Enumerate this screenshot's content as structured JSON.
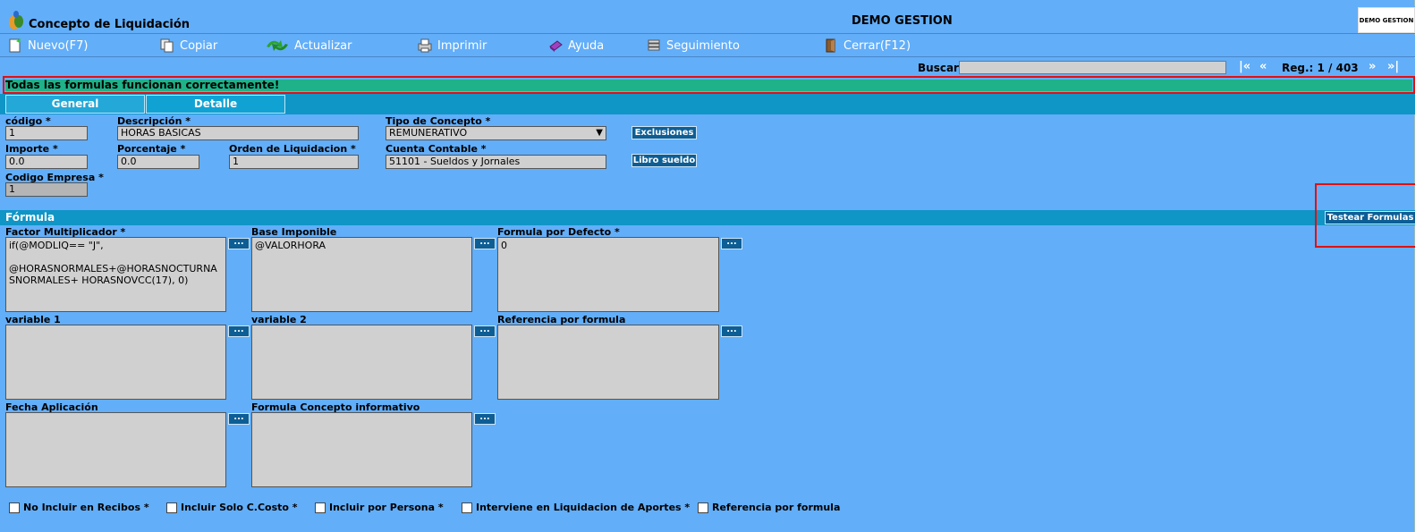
{
  "window": {
    "title": "Concepto de Liquidación",
    "company": "DEMO GESTION",
    "company_logo_text": "DEMO GESTION"
  },
  "toolbar": {
    "items": [
      {
        "label": "Nuevo(F7)",
        "icon": "new-document-icon"
      },
      {
        "label": "Copiar",
        "icon": "copy-icon"
      },
      {
        "label": "Actualizar",
        "icon": "refresh-icon"
      },
      {
        "label": "Imprimir",
        "icon": "printer-icon"
      },
      {
        "label": "Ayuda",
        "icon": "help-book-icon"
      },
      {
        "label": "Seguimiento",
        "icon": "tracking-icon"
      },
      {
        "label": "Cerrar(F12)",
        "icon": "exit-door-icon"
      }
    ]
  },
  "search": {
    "label": "Buscar",
    "value": "",
    "first": "|«",
    "prev": "«",
    "record": "Reg.: 1 / 403",
    "next": "»",
    "last": "»|"
  },
  "status_message": "Todas las formulas funcionan correctamente!",
  "tabs": [
    "General",
    "Detalle"
  ],
  "fields": {
    "codigo": {
      "label": "código *",
      "value": "1"
    },
    "descripcion": {
      "label": "Descripción *",
      "value": "HORAS BASICAS"
    },
    "tipo_concepto": {
      "label": "Tipo de Concepto *",
      "value": "REMUNERATIVO"
    },
    "exclusiones_button": "Exclusiones",
    "importe": {
      "label": "Importe *",
      "value": "0.0"
    },
    "porcentaje": {
      "label": "Porcentaje *",
      "value": "0.0"
    },
    "orden": {
      "label": "Orden de Liquidacion *",
      "value": "1"
    },
    "cuenta": {
      "label": "Cuenta Contable *",
      "value": "51101 - Sueldos y Jornales"
    },
    "libro_button": "Libro sueldo",
    "codigo_empresa": {
      "label": "Codigo Empresa *",
      "value": "1"
    }
  },
  "formula": {
    "section_title": "Fórmula",
    "test_button": "Testear Formulas",
    "factor": {
      "label": "Factor Multiplicador *",
      "value": "if(@MODLIQ== \"J\",\n\n@HORASNORMALES+@HORASNOCTURNA\nSNORMALES+ HORASNOVCC(17), 0)"
    },
    "base": {
      "label": "Base Imponible",
      "value": "@VALORHORA"
    },
    "defecto": {
      "label": "Formula por Defecto *",
      "value": "0"
    },
    "variable1": {
      "label": "variable 1",
      "value": ""
    },
    "variable2": {
      "label": "variable 2",
      "value": ""
    },
    "referencia": {
      "label": "Referencia por formula",
      "value": ""
    },
    "fecha": {
      "label": "Fecha Aplicación",
      "value": ""
    },
    "informativo": {
      "label": "Formula Concepto informativo",
      "value": ""
    },
    "dots_label": "..."
  },
  "checkboxes": [
    {
      "label": "No Incluir en Recibos *",
      "checked": false
    },
    {
      "label": "Incluir Solo C.Costo *",
      "checked": false
    },
    {
      "label": "Incluir por Persona *",
      "checked": false
    },
    {
      "label": "Interviene en Liquidacion de Aportes *",
      "checked": false
    },
    {
      "label": "Referencia por formula",
      "checked": false
    }
  ]
}
